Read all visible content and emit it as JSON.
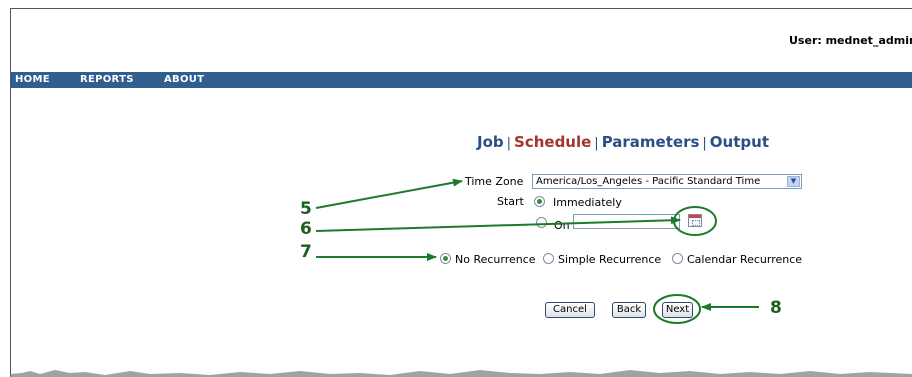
{
  "header": {
    "user_label": "User: mednet_admin"
  },
  "nav": {
    "items": [
      {
        "label": "HOME"
      },
      {
        "label": "REPORTS"
      },
      {
        "label": "ABOUT"
      }
    ]
  },
  "wizard": {
    "steps": [
      {
        "label": "Job"
      },
      {
        "label": "Schedule",
        "current": true
      },
      {
        "label": "Parameters"
      },
      {
        "label": "Output"
      }
    ],
    "separator": "|"
  },
  "form": {
    "time_zone_label": "Time Zone",
    "time_zone_value": "America/Los_Angeles - Pacific Standard Time",
    "start_label": "Start",
    "start_immediately": "Immediately",
    "start_on": "On",
    "start_on_date": "",
    "recurrence": [
      {
        "label": "No Recurrence",
        "selected": true
      },
      {
        "label": "Simple Recurrence",
        "selected": false
      },
      {
        "label": "Calendar Recurrence",
        "selected": false
      }
    ]
  },
  "buttons": {
    "cancel": "Cancel",
    "back": "Back",
    "next": "Next"
  },
  "annotations": {
    "n5": "5",
    "n6": "6",
    "n7": "7",
    "n8": "8",
    "color": "#1e7a2a"
  },
  "colors": {
    "navbar": "#2f5e8f",
    "step_link": "#2a4f86",
    "step_current": "#a33529"
  }
}
